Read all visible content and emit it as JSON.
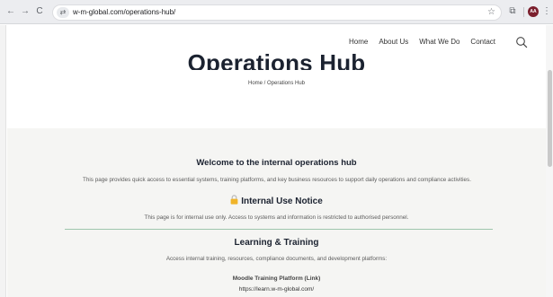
{
  "browser": {
    "url": "w-m-global.com/operations-hub/",
    "back_glyph": "←",
    "forward_glyph": "→",
    "reload_glyph": "C",
    "site_info_glyph": "⇄",
    "star_glyph": "☆",
    "extensions_glyph": "⧉",
    "profile_initials": "AA",
    "menu_glyph": "⋮"
  },
  "nav": {
    "items": [
      "Home",
      "About Us",
      "What We Do",
      "Contact"
    ]
  },
  "hero": {
    "title": "Operations Hub",
    "breadcrumb": "Home / Operations Hub"
  },
  "content": {
    "welcome_heading": "Welcome to the internal operations hub",
    "intro_text": "This page provides quick access to essential systems, training platforms, and key business resources to support daily operations and compliance activities.",
    "notice_heading": "Internal Use Notice",
    "notice_text": "This page is for internal use only. Access to systems and information is restricted to authorised personnel.",
    "learning_heading": "Learning & Training",
    "learning_text": "Access internal training, resources, compliance documents, and development platforms:",
    "link_title": "Moodle Training Platform (Link)",
    "link_url": "https://learn.w-m-global.com/"
  },
  "colors": {
    "heading": "#1b2230",
    "divider": "#9ec5ad",
    "content_bg": "#f5f5f3",
    "lock": "#f0b429"
  },
  "icons": {
    "search": "search-icon",
    "lock": "lock-icon"
  }
}
